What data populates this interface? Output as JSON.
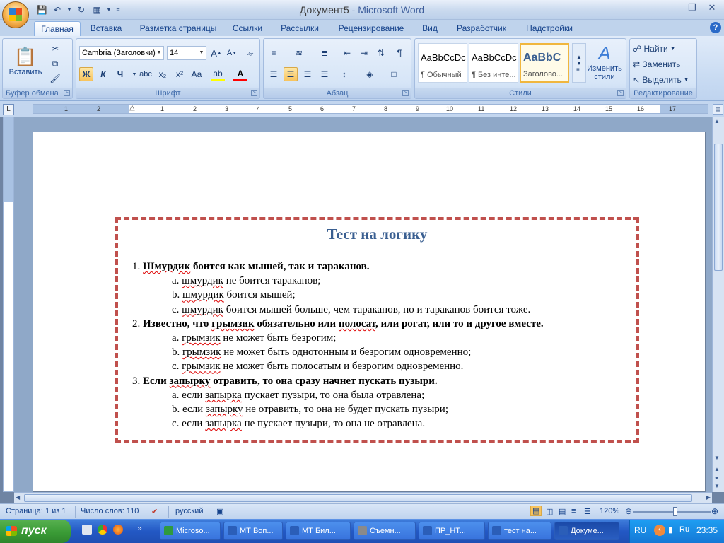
{
  "window": {
    "doc_title": "Документ5",
    "separator": " - ",
    "app_name": "Microsoft Word"
  },
  "quick_access": [
    "save-icon",
    "undo-icon",
    "redo-icon",
    "print-preview-icon",
    "customize-icon"
  ],
  "tabs": [
    "Главная",
    "Вставка",
    "Разметка страницы",
    "Ссылки",
    "Рассылки",
    "Рецензирование",
    "Вид",
    "Разработчик",
    "Надстройки"
  ],
  "ribbon": {
    "clipboard": {
      "label": "Буфер обмена",
      "paste_label": "Вставить"
    },
    "font": {
      "label": "Шрифт",
      "font_name": "Cambria (Заголовки)",
      "font_size": "14",
      "bold": "Ж",
      "italic": "К",
      "underline": "Ч",
      "strike": "abc",
      "subscript": "x₂",
      "superscript": "x²",
      "case": "Aa"
    },
    "paragraph": {
      "label": "Абзац"
    },
    "styles": {
      "label": "Стили",
      "items": [
        {
          "sample": "AaBbCcDc",
          "name": "¶ Обычный"
        },
        {
          "sample": "AaBbCcDc",
          "name": "¶ Без инте..."
        },
        {
          "sample": "AaBbC",
          "name": "Заголово..."
        }
      ],
      "change_styles": "Изменить стили"
    },
    "editing": {
      "label": "Редактирование",
      "find": "Найти",
      "replace": "Заменить",
      "select": "Выделить"
    }
  },
  "ruler": {
    "numbers": [
      "1",
      "2",
      "1",
      "2",
      "3",
      "4",
      "5",
      "6",
      "7",
      "8",
      "9",
      "10",
      "11",
      "12",
      "13",
      "14",
      "15",
      "16",
      "17"
    ]
  },
  "document": {
    "title": "Тест на логику",
    "questions": [
      {
        "num": "1.",
        "parts": [
          {
            "t": "Шмурдик",
            "sq": true
          },
          {
            "t": " боится как мышей, так и тараканов.",
            "sq": false
          }
        ],
        "answers": [
          {
            "letter": "a.",
            "parts": [
              {
                "t": "шмурдик",
                "sq": true
              },
              {
                "t": " не боится тараканов;",
                "sq": false
              }
            ]
          },
          {
            "letter": "b.",
            "parts": [
              {
                "t": "шмурдик",
                "sq": true
              },
              {
                "t": " боится мышей;",
                "sq": false
              }
            ]
          },
          {
            "letter": "c.",
            "parts": [
              {
                "t": "шмурдик",
                "sq": true
              },
              {
                "t": " боится мышей больше, чем тараканов, но и тараканов боится тоже.",
                "sq": false
              }
            ]
          }
        ]
      },
      {
        "num": "2.",
        "parts": [
          {
            "t": "Известно, что ",
            "sq": false
          },
          {
            "t": "грымзик",
            "sq": true
          },
          {
            "t": " обязательно или ",
            "sq": false
          },
          {
            "t": "полосат",
            "sq": true
          },
          {
            "t": ", или рогат, или то и другое вместе.",
            "sq": false
          }
        ],
        "answers": [
          {
            "letter": "a.",
            "parts": [
              {
                "t": "грымзик",
                "sq": true
              },
              {
                "t": " не может быть безрогим;",
                "sq": false
              }
            ]
          },
          {
            "letter": "b.",
            "parts": [
              {
                "t": "грымзик",
                "sq": true
              },
              {
                "t": " не может быть однотонным и безрогим одновременно;",
                "sq": false
              }
            ]
          },
          {
            "letter": "c.",
            "parts": [
              {
                "t": "грымзик",
                "sq": true
              },
              {
                "t": " не может быть полосатым и безрогим одновременно.",
                "sq": false
              }
            ]
          }
        ]
      },
      {
        "num": "3.",
        "parts": [
          {
            "t": "Если ",
            "sq": false
          },
          {
            "t": "запырку",
            "sq": true
          },
          {
            "t": " отравить, то она сразу начнет пускать пузыри.",
            "sq": false
          }
        ],
        "answers": [
          {
            "letter": "a.",
            "parts": [
              {
                "t": "если ",
                "sq": false
              },
              {
                "t": "запырка",
                "sq": true
              },
              {
                "t": " пускает пузыри, то она была отравлена;",
                "sq": false
              }
            ]
          },
          {
            "letter": "b.",
            "parts": [
              {
                "t": "если ",
                "sq": false
              },
              {
                "t": "запырку",
                "sq": true
              },
              {
                "t": " не отравить, то она не будет пускать пузыри;",
                "sq": false
              }
            ]
          },
          {
            "letter": "c.",
            "parts": [
              {
                "t": "если ",
                "sq": false
              },
              {
                "t": "запырка",
                "sq": true
              },
              {
                "t": " не пускает пузыри, то она не отравлена.",
                "sq": false
              }
            ]
          }
        ]
      }
    ]
  },
  "status": {
    "page": "Страница: 1 из 1",
    "words": "Число слов: 110",
    "language": "русский",
    "zoom": "120%"
  },
  "taskbar": {
    "start": "пуск",
    "items": [
      {
        "label": "Microso...",
        "active": false
      },
      {
        "label": "МТ Воп...",
        "active": false
      },
      {
        "label": "МТ Бил...",
        "active": false
      },
      {
        "label": "Съемн...",
        "active": false
      },
      {
        "label": "ПР_НТ...",
        "active": false
      },
      {
        "label": "тест на...",
        "active": false
      },
      {
        "label": "Докуме...",
        "active": true
      }
    ],
    "lang": "RU",
    "lang2": "Ru",
    "time": "23:35"
  },
  "colors": {
    "box_border": "#c0504d",
    "title": "#3a5f91",
    "ribbon_bg": "#c7daf2"
  }
}
